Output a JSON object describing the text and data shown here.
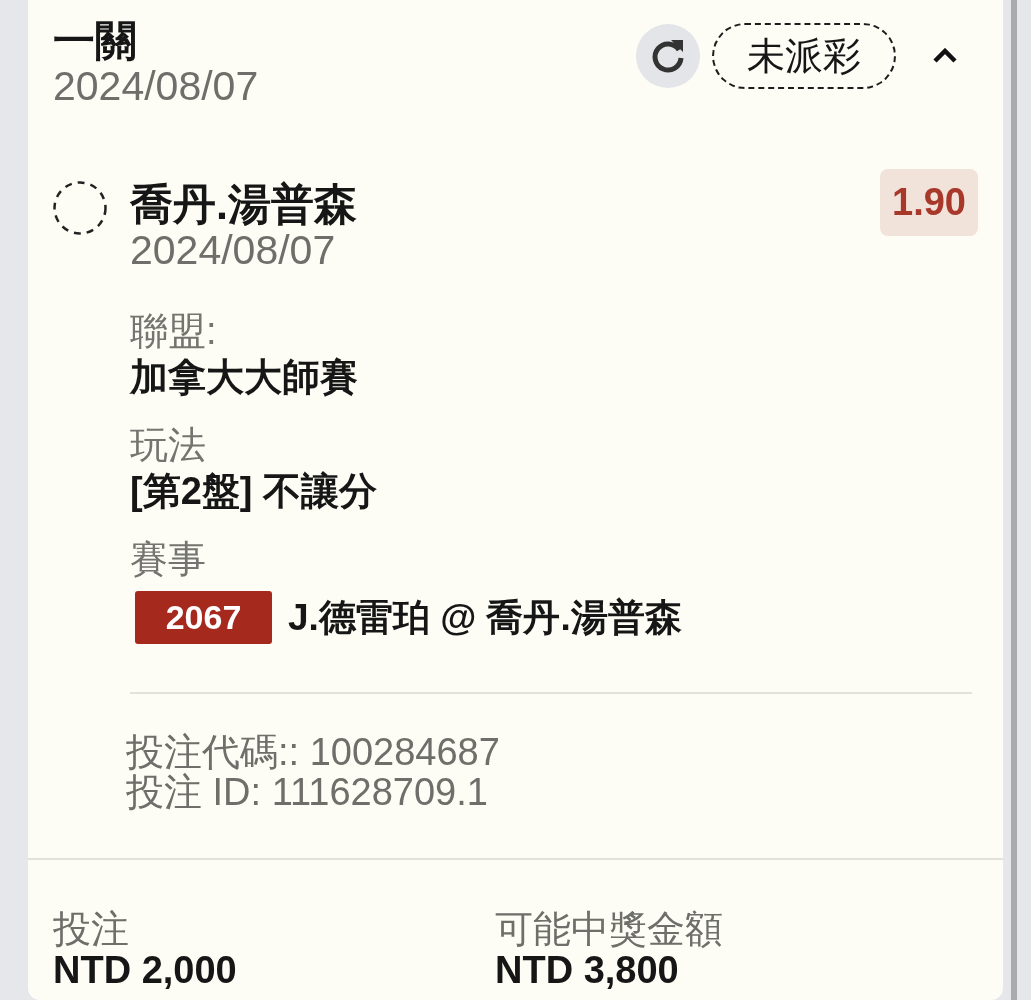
{
  "bet": {
    "type_label": "一關",
    "date": "2024/08/07",
    "status": "未派彩",
    "expanded": true
  },
  "selection": {
    "name": "喬丹.湯普森",
    "date": "2024/08/07",
    "odds": "1.90",
    "details": [
      {
        "label": "聯盟:",
        "value": "加拿大大師賽"
      },
      {
        "label": "玩法",
        "value": "[第2盤] 不讓分"
      }
    ],
    "event": {
      "label": "賽事",
      "match_number": "2067",
      "teams": "J.德雷珀 @ 喬丹.湯普森"
    }
  },
  "references": [
    "投注代碼:: 100284687",
    "投注 ID: 111628709.1"
  ],
  "summary": [
    {
      "label": "投注",
      "value": "NTD 2,000"
    },
    {
      "label": "可能中獎金額",
      "value": "NTD 3,800"
    }
  ]
}
